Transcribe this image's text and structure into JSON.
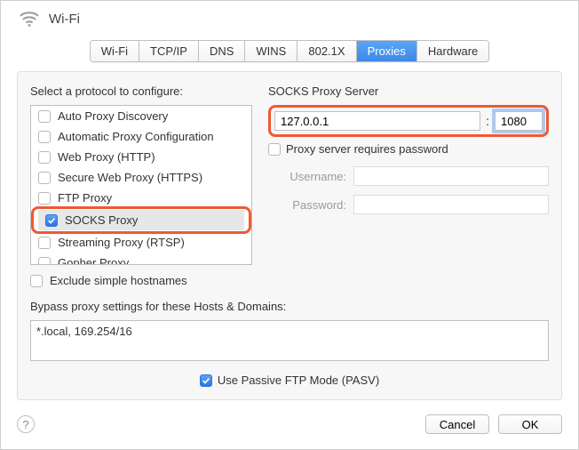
{
  "header": {
    "title": "Wi-Fi"
  },
  "tabs": {
    "wifi": "Wi-Fi",
    "tcpip": "TCP/IP",
    "dns": "DNS",
    "wins": "WINS",
    "8021x": "802.1X",
    "proxies": "Proxies",
    "hardware": "Hardware",
    "active": "proxies"
  },
  "left": {
    "select_label": "Select a protocol to configure:",
    "protocols": [
      {
        "label": "Auto Proxy Discovery",
        "checked": false,
        "selected": false
      },
      {
        "label": "Automatic Proxy Configuration",
        "checked": false,
        "selected": false
      },
      {
        "label": "Web Proxy (HTTP)",
        "checked": false,
        "selected": false
      },
      {
        "label": "Secure Web Proxy (HTTPS)",
        "checked": false,
        "selected": false
      },
      {
        "label": "FTP Proxy",
        "checked": false,
        "selected": false
      },
      {
        "label": "SOCKS Proxy",
        "checked": true,
        "selected": true
      },
      {
        "label": "Streaming Proxy (RTSP)",
        "checked": false,
        "selected": false
      },
      {
        "label": "Gopher Proxy",
        "checked": false,
        "selected": false
      }
    ],
    "exclude_simple": {
      "label": "Exclude simple hostnames",
      "checked": false
    }
  },
  "right": {
    "server_label": "SOCKS Proxy Server",
    "host": "127.0.0.1",
    "port": "1080",
    "requires_password": {
      "label": "Proxy server requires password",
      "checked": false
    },
    "username_label": "Username:",
    "username_value": "",
    "password_label": "Password:",
    "password_value": ""
  },
  "bypass": {
    "label": "Bypass proxy settings for these Hosts & Domains:",
    "value": "*.local, 169.254/16"
  },
  "pasv": {
    "label": "Use Passive FTP Mode (PASV)",
    "checked": true
  },
  "footer": {
    "help": "?",
    "cancel": "Cancel",
    "ok": "OK"
  },
  "colors": {
    "highlight": "#ee5a33",
    "accent": "#3f87e6"
  }
}
